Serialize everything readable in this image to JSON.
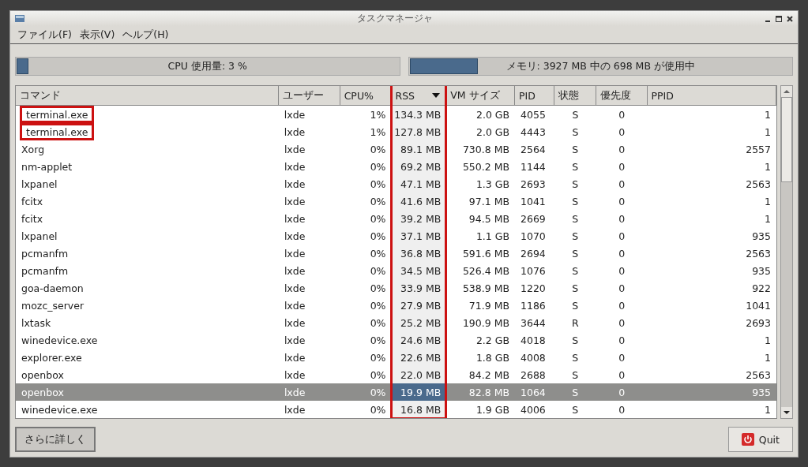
{
  "window": {
    "title": "タスクマネージャ"
  },
  "menu": [
    "ファイル(F)",
    "表示(V)",
    "ヘルプ(H)"
  ],
  "cpu": {
    "label": "CPU 使用量: 3 %",
    "level": 0.03
  },
  "memory": {
    "label": "メモリ: 3927 MB 中の 698 MB が使用中",
    "level": 0.178
  },
  "table": {
    "columns": [
      {
        "label": "コマンド",
        "sorted": false,
        "highlighted": false
      },
      {
        "label": "ユーザー",
        "sorted": false,
        "highlighted": false
      },
      {
        "label": "CPU%",
        "sorted": false,
        "highlighted": false
      },
      {
        "label": "RSS",
        "sorted": true,
        "highlighted": true
      },
      {
        "label": "VM サイズ",
        "sorted": false,
        "highlighted": false
      },
      {
        "label": "PID",
        "sorted": false,
        "highlighted": false
      },
      {
        "label": "状態",
        "sorted": false,
        "highlighted": false
      },
      {
        "label": "優先度",
        "sorted": false,
        "highlighted": false
      },
      {
        "label": "PPID",
        "sorted": false,
        "highlighted": false
      }
    ],
    "rows": [
      {
        "selected": false,
        "highlighted": true,
        "cells": [
          "terminal.exe",
          "lxde",
          "1%",
          "134.3 MB",
          "2.0 GB",
          "4055",
          "S",
          "0",
          "1"
        ]
      },
      {
        "selected": false,
        "highlighted": true,
        "cells": [
          "terminal.exe",
          "lxde",
          "1%",
          "127.8 MB",
          "2.0 GB",
          "4443",
          "S",
          "0",
          "1"
        ]
      },
      {
        "selected": false,
        "highlighted": false,
        "cells": [
          "Xorg",
          "lxde",
          "0%",
          "89.1 MB",
          "730.8 MB",
          "2564",
          "S",
          "0",
          "2557"
        ]
      },
      {
        "selected": false,
        "highlighted": false,
        "cells": [
          "nm-applet",
          "lxde",
          "0%",
          "69.2 MB",
          "550.2 MB",
          "1144",
          "S",
          "0",
          "1"
        ]
      },
      {
        "selected": false,
        "highlighted": false,
        "cells": [
          "lxpanel",
          "lxde",
          "0%",
          "47.1 MB",
          "1.3 GB",
          "2693",
          "S",
          "0",
          "2563"
        ]
      },
      {
        "selected": false,
        "highlighted": false,
        "cells": [
          "fcitx",
          "lxde",
          "0%",
          "41.6 MB",
          "97.1 MB",
          "1041",
          "S",
          "0",
          "1"
        ]
      },
      {
        "selected": false,
        "highlighted": false,
        "cells": [
          "fcitx",
          "lxde",
          "0%",
          "39.2 MB",
          "94.5 MB",
          "2669",
          "S",
          "0",
          "1"
        ]
      },
      {
        "selected": false,
        "highlighted": false,
        "cells": [
          "lxpanel",
          "lxde",
          "0%",
          "37.1 MB",
          "1.1 GB",
          "1070",
          "S",
          "0",
          "935"
        ]
      },
      {
        "selected": false,
        "highlighted": false,
        "cells": [
          "pcmanfm",
          "lxde",
          "0%",
          "36.8 MB",
          "591.6 MB",
          "2694",
          "S",
          "0",
          "2563"
        ]
      },
      {
        "selected": false,
        "highlighted": false,
        "cells": [
          "pcmanfm",
          "lxde",
          "0%",
          "34.5 MB",
          "526.4 MB",
          "1076",
          "S",
          "0",
          "935"
        ]
      },
      {
        "selected": false,
        "highlighted": false,
        "cells": [
          "goa-daemon",
          "lxde",
          "0%",
          "33.9 MB",
          "538.9 MB",
          "1220",
          "S",
          "0",
          "922"
        ]
      },
      {
        "selected": false,
        "highlighted": false,
        "cells": [
          "mozc_server",
          "lxde",
          "0%",
          "27.9 MB",
          "71.9 MB",
          "1186",
          "S",
          "0",
          "1041"
        ]
      },
      {
        "selected": false,
        "highlighted": false,
        "cells": [
          "lxtask",
          "lxde",
          "0%",
          "25.2 MB",
          "190.9 MB",
          "3644",
          "R",
          "0",
          "2693"
        ]
      },
      {
        "selected": false,
        "highlighted": false,
        "cells": [
          "winedevice.exe",
          "lxde",
          "0%",
          "24.6 MB",
          "2.2 GB",
          "4018",
          "S",
          "0",
          "1"
        ]
      },
      {
        "selected": false,
        "highlighted": false,
        "cells": [
          "explorer.exe",
          "lxde",
          "0%",
          "22.6 MB",
          "1.8 GB",
          "4008",
          "S",
          "0",
          "1"
        ]
      },
      {
        "selected": false,
        "highlighted": false,
        "cells": [
          "openbox",
          "lxde",
          "0%",
          "22.0 MB",
          "84.2 MB",
          "2688",
          "S",
          "0",
          "2563"
        ]
      },
      {
        "selected": true,
        "highlighted": false,
        "cells": [
          "openbox",
          "lxde",
          "0%",
          "19.9 MB",
          "82.8 MB",
          "1064",
          "S",
          "0",
          "935"
        ]
      },
      {
        "selected": false,
        "highlighted": false,
        "cells": [
          "winedevice.exe",
          "lxde",
          "0%",
          "16.8 MB",
          "1.9 GB",
          "4006",
          "S",
          "0",
          "1"
        ]
      }
    ]
  },
  "buttons": [
    {
      "kind": "details",
      "label": "さらに詳しく"
    },
    {
      "kind": "quit",
      "label": "Quit"
    }
  ]
}
